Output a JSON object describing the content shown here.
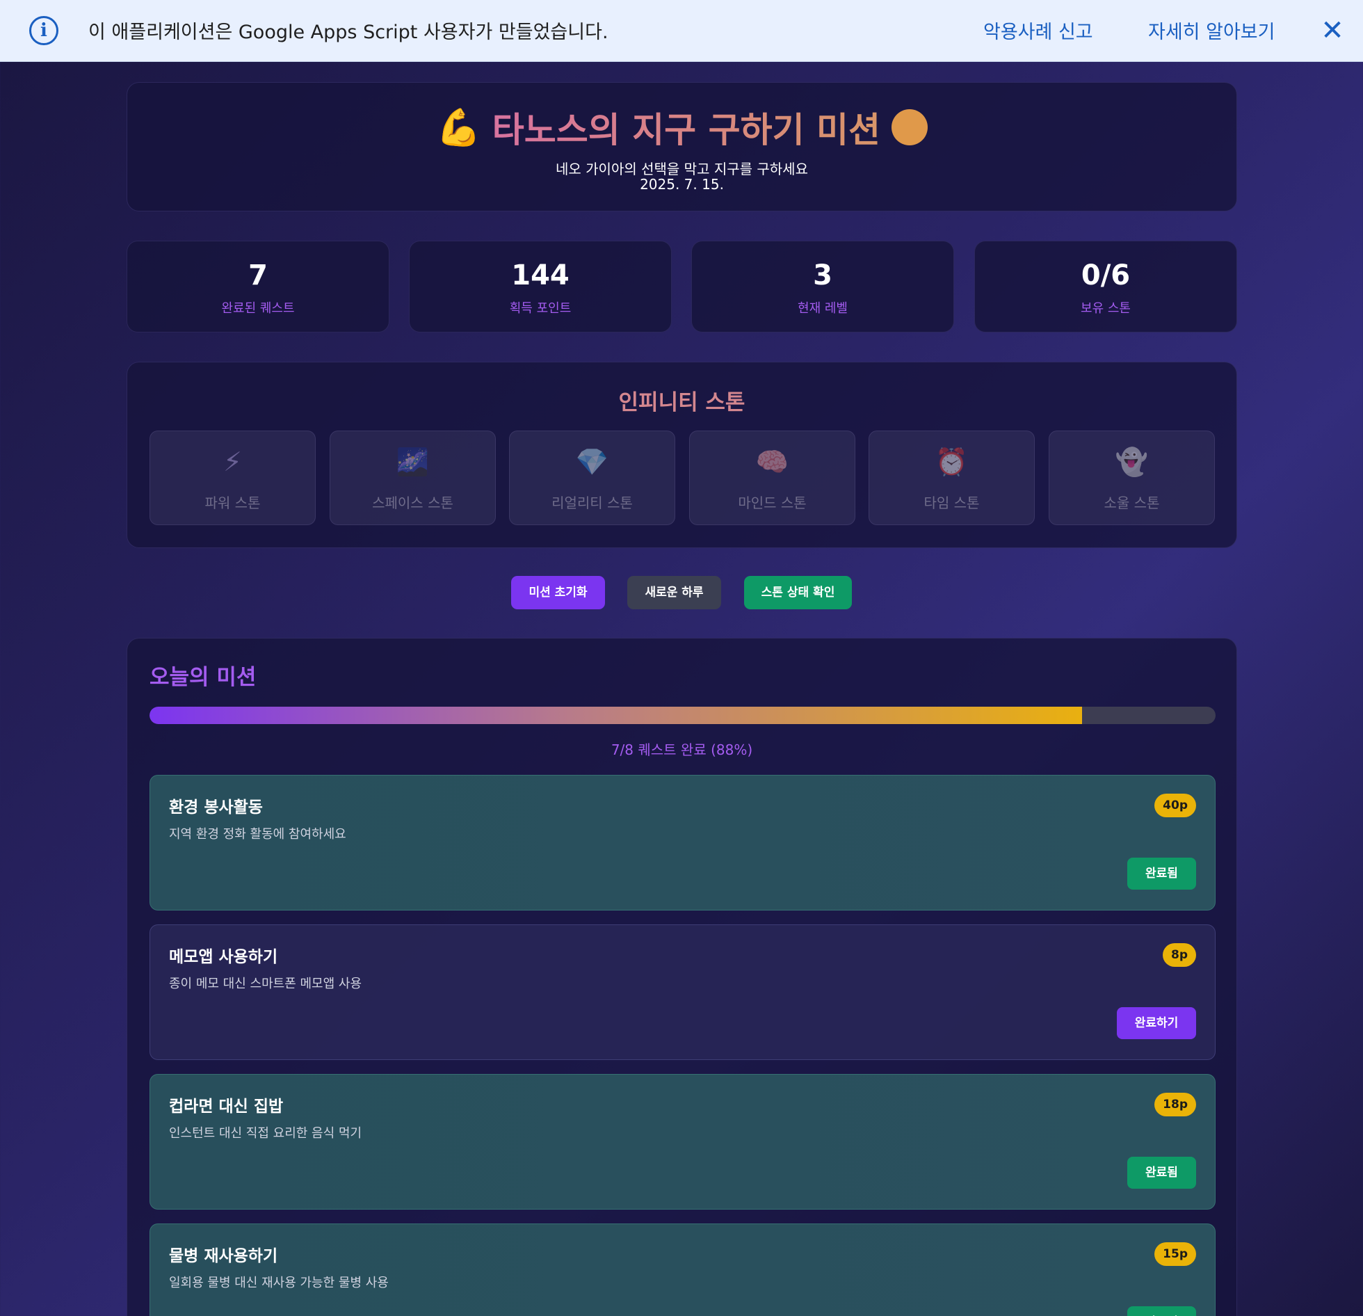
{
  "banner": {
    "info_icon": "info-icon",
    "text": "이 애플리케이션은 Google Apps Script 사용자가 만들었습니다.",
    "report_link": "악용사례 신고",
    "learn_link": "자세히 알아보기",
    "close_icon": "close-icon"
  },
  "header": {
    "emoji": "💪",
    "title": "타노스의 지구 구하기 미션",
    "subtitle": "네오 가이아의 선택을 막고 지구를 구하세요",
    "date": "2025. 7. 15."
  },
  "stats": [
    {
      "value": "7",
      "label": "완료된 퀘스트"
    },
    {
      "value": "144",
      "label": "획득 포인트"
    },
    {
      "value": "3",
      "label": "현재 레벨"
    },
    {
      "value": "0/6",
      "label": "보유 스톤"
    }
  ],
  "stones": {
    "title": "인피니티 스톤",
    "items": [
      {
        "icon": "⚡",
        "label": "파워 스톤"
      },
      {
        "icon": "🌌",
        "label": "스페이스 스톤"
      },
      {
        "icon": "💎",
        "label": "리얼리티 스톤"
      },
      {
        "icon": "🧠",
        "label": "마인드 스톤"
      },
      {
        "icon": "⏰",
        "label": "타임 스톤"
      },
      {
        "icon": "👻",
        "label": "소울 스톤"
      }
    ]
  },
  "actions": {
    "reset": "미션 초기화",
    "new_day": "새로운 하루",
    "check_stones": "스톤 상태 확인"
  },
  "missions": {
    "title": "오늘의 미션",
    "progress_fraction": 0.875,
    "progress_text": "7/8 퀘스트 완료 (88%)",
    "items": [
      {
        "title": "환경 봉사활동",
        "desc": "지역 환경 정화 활동에 참여하세요",
        "points": "40p",
        "button": "완료됨",
        "done": true
      },
      {
        "title": "메모앱 사용하기",
        "desc": "종이 메모 대신 스마트폰 메모앱 사용",
        "points": "8p",
        "button": "완료하기",
        "done": false
      },
      {
        "title": "컵라면 대신 집밥",
        "desc": "인스턴트 대신 직접 요리한 음식 먹기",
        "points": "18p",
        "button": "완료됨",
        "done": true
      },
      {
        "title": "물병 재사용하기",
        "desc": "일회용 물병 대신 재사용 가능한 물병 사용",
        "points": "15p",
        "button": "완료됨",
        "done": true
      }
    ]
  },
  "colors": {
    "accent_purple": "#7b35f0",
    "success_green": "#0e9a66",
    "points_yellow": "#eab308",
    "banner_bg": "#e8f0fe",
    "link_blue": "#1a5fc1"
  }
}
